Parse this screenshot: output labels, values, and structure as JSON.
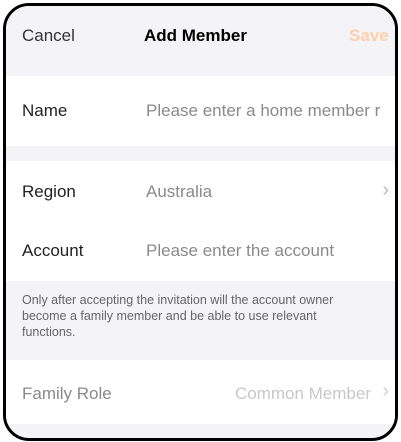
{
  "header": {
    "cancel_label": "Cancel",
    "title": "Add Member",
    "save_label": "Save"
  },
  "form": {
    "name_label": "Name",
    "name_placeholder": "Please enter a home member r",
    "region_label": "Region",
    "region_value": "Australia",
    "account_label": "Account",
    "account_placeholder": "Please enter the account",
    "note": "Only after accepting the invitation will the account owner become a family member and be able to use relevant functions.",
    "role_label": "Family Role",
    "role_value": "Common Member"
  },
  "icons": {
    "chevron": "chevron-right-icon"
  },
  "colors": {
    "save_disabled": "#ffcfae",
    "background": "#f4f4f6"
  }
}
